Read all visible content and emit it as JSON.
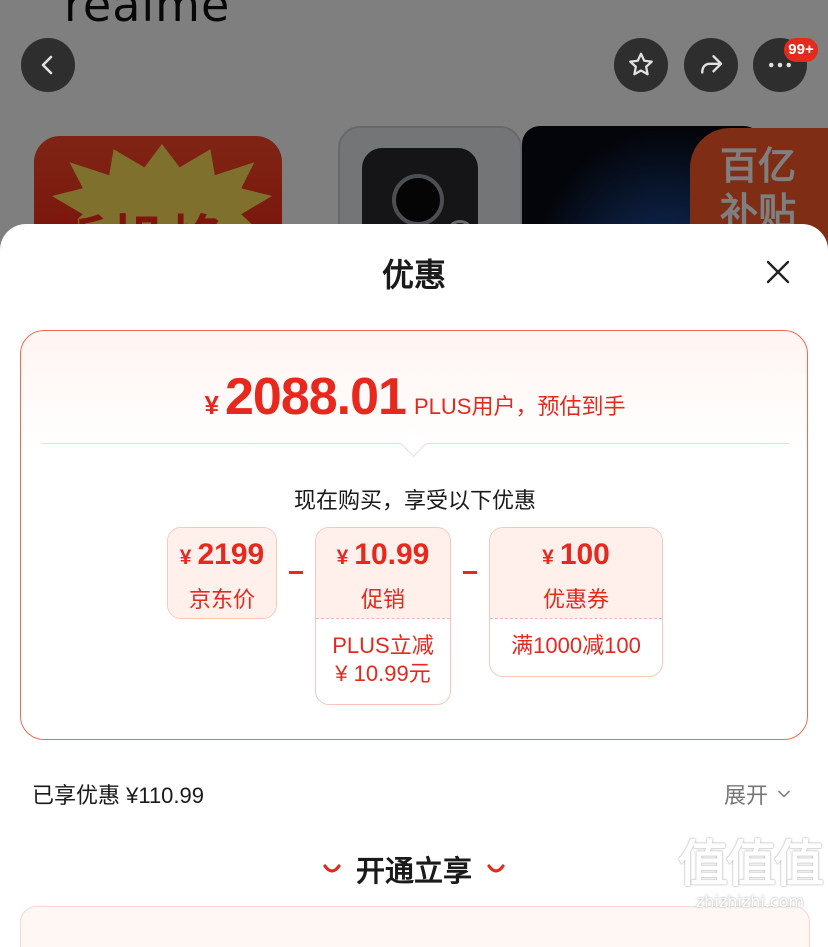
{
  "product_page": {
    "brand": "realme",
    "banner_left_text": "新机焕",
    "banner_badge_text": [
      "百亿",
      "补贴"
    ],
    "cart_badge": "99+"
  },
  "sheet": {
    "title": "优惠",
    "estimate": {
      "currency": "¥",
      "price": "2088.01",
      "note": "PLUS用户，预估到手"
    },
    "enjoy_text": "现在购买，享受以下优惠",
    "breakdown": {
      "jd_price": {
        "currency": "¥",
        "amount": "2199",
        "label": "京东价"
      },
      "promo": {
        "currency": "¥",
        "amount": "10.99",
        "label": "促销",
        "detail_1": "PLUS立减",
        "detail_2": "¥ 10.99元"
      },
      "coupon": {
        "currency": "¥",
        "amount": "100",
        "label": "优惠券",
        "detail_1": "满1000减100"
      }
    },
    "enjoyed_summary": "已享优惠 ¥110.99",
    "expand_label": "展开",
    "open_section_title": "开通立享"
  },
  "watermark": {
    "logo": "值值值",
    "url": "zhizhizhi.com"
  },
  "colors": {
    "accent": "#e8281d",
    "card_border": "#f06a55",
    "box_fill": "#fff0ec"
  }
}
